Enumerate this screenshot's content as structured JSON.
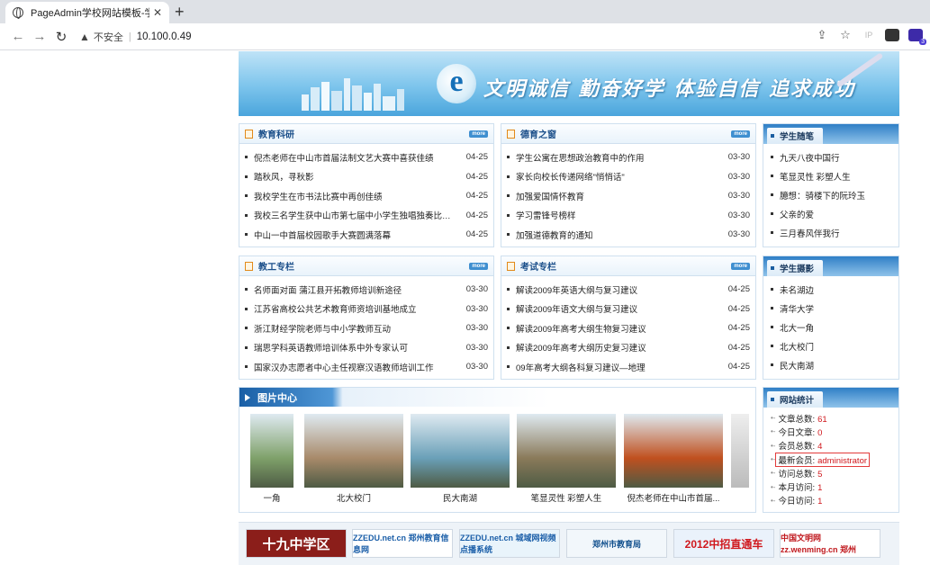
{
  "browser": {
    "tab_title": "PageAdmin学校网站模板-学校",
    "tab_close": "✕",
    "new_tab": "+",
    "insecure_label": "不安全",
    "url": "10.100.0.49",
    "separator": "|",
    "ext_badge": "3"
  },
  "banner": {
    "slogan": "文明诚信 勤奋好学 体验自信 追求成功"
  },
  "sections": {
    "jiaoyu": {
      "title": "教育科研",
      "more": "more",
      "items": [
        {
          "title": "倪杰老师在中山市首届法制文艺大赛中喜获佳绩",
          "date": "04-25"
        },
        {
          "title": "踏秋风，寻秋影",
          "date": "04-25"
        },
        {
          "title": "我校学生在市书法比赛中再创佳绩",
          "date": "04-25"
        },
        {
          "title": "我校三名学生获中山市第七届中小学生独唱独奏比赛...",
          "date": "04-25"
        },
        {
          "title": "中山一中首届校园歌手大赛圆满落幕",
          "date": "04-25"
        }
      ]
    },
    "deyu": {
      "title": "德育之窗",
      "more": "more",
      "items": [
        {
          "title": "学生公寓在思想政治教育中的作用",
          "date": "03-30"
        },
        {
          "title": "家长向校长传递网络\"悄悄话\"",
          "date": "03-30"
        },
        {
          "title": "加强爱国情怀教育",
          "date": "03-30"
        },
        {
          "title": "学习雷锋号榜样",
          "date": "03-30"
        },
        {
          "title": "加强道德教育的通知",
          "date": "03-30"
        }
      ]
    },
    "jiaogong": {
      "title": "教工专栏",
      "more": "more",
      "items": [
        {
          "title": "名师面对面 蒲江县开拓教师培训新途径",
          "date": "03-30"
        },
        {
          "title": "江苏省高校公共艺术教育师资培训基地成立",
          "date": "03-30"
        },
        {
          "title": "浙江财经学院老师与中小学教师互动",
          "date": "03-30"
        },
        {
          "title": "瑞思学科英语教师培训体系中外专家认可",
          "date": "03-30"
        },
        {
          "title": "国家汉办志愿者中心主任视察汉语教师培训工作",
          "date": "03-30"
        }
      ]
    },
    "kaoshi": {
      "title": "考试专栏",
      "more": "more",
      "items": [
        {
          "title": "解读2009年英语大纲与复习建议",
          "date": "04-25"
        },
        {
          "title": "解读2009年语文大纲与复习建议",
          "date": "04-25"
        },
        {
          "title": "解读2009年高考大纲生物复习建议",
          "date": "04-25"
        },
        {
          "title": "解读2009年高考大纲历史复习建议",
          "date": "04-25"
        },
        {
          "title": "09年高考大纲各科复习建议—地理",
          "date": "04-25"
        }
      ]
    }
  },
  "side": {
    "suibi": {
      "title": "学生随笔",
      "items": [
        "九天八夜中国行",
        "笔显灵性 彩塑人生",
        "臆想：骑楼下的阮玲玉",
        "父亲的爱",
        "三月春风伴我行"
      ]
    },
    "sheying": {
      "title": "学生摄影",
      "items": [
        "未名湖边",
        "清华大学",
        "北大一角",
        "北大校门",
        "民大南湖"
      ]
    },
    "stats": {
      "title": "网站统计",
      "items": [
        {
          "label": "文章总数:",
          "value": "61"
        },
        {
          "label": "今日文章:",
          "value": "0"
        },
        {
          "label": "会员总数:",
          "value": "4"
        },
        {
          "label": "最新会员:",
          "value": "administrator"
        },
        {
          "label": "访问总数:",
          "value": "5"
        },
        {
          "label": "本月访问:",
          "value": "1"
        },
        {
          "label": "今日访问:",
          "value": "1"
        }
      ]
    }
  },
  "pictures": {
    "title": "图片中心",
    "items": [
      {
        "caption": "一角",
        "color": "#7fa16a"
      },
      {
        "caption": "北大校门",
        "color": "#a88a6a"
      },
      {
        "caption": "民大南湖",
        "color": "#6aa0b8"
      },
      {
        "caption": "笔显灵性 彩塑人生",
        "color": "#8a7a5a"
      },
      {
        "caption": "倪杰老师在中山市首届...",
        "color": "#c0501f"
      }
    ]
  },
  "links": [
    {
      "label": "十九中学区",
      "bg": "#8b1e1a",
      "fg": "#ffffff"
    },
    {
      "label": "ZZEDU.net.cn 郑州教育信息网",
      "bg": "#ffffff",
      "fg": "#1a5ea8"
    },
    {
      "label": "ZZEDU.net.cn 城域网视频点播系统",
      "bg": "#e9f4fb",
      "fg": "#1a5ea8"
    },
    {
      "label": "郑州市教育局",
      "bg": "#f2f7fb",
      "fg": "#0f4e8c"
    },
    {
      "label": "2012中招直通车",
      "bg": "#eaf2fb",
      "fg": "#d0181d"
    },
    {
      "label": "中国文明网 zz.wenming.cn 郑州",
      "bg": "#ffffff",
      "fg": "#c0181d"
    }
  ]
}
